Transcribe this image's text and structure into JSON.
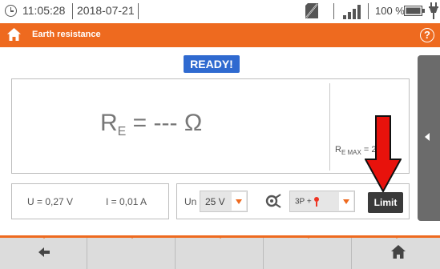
{
  "statusbar": {
    "time": "11:05:28",
    "date": "2018-07-21",
    "battery_percent": "100 %",
    "icons": [
      "clock-icon",
      "sd-card-icon",
      "signal-icon",
      "battery-icon",
      "plug-icon"
    ]
  },
  "titlebar": {
    "title": "Earth resistance",
    "help_label": "?",
    "icons": [
      "home-icon",
      "help-icon"
    ]
  },
  "status_badge": "READY!",
  "measurement": {
    "symbol": "R",
    "subscript": "E",
    "value_text": " = --- Ω",
    "remax_symbol": "R",
    "remax_subscript": "E MAX",
    "remax_value": " = 2  Ω"
  },
  "readings": {
    "voltage": "U = 0,27 V",
    "current": "I = 0,01 A"
  },
  "controls": {
    "un_label": "Un",
    "un_value": "25 V",
    "method_value": "3P + ",
    "limit_label": "Limit"
  },
  "colors": {
    "accent": "#ee6a1f",
    "ready": "#2f6ad0",
    "arrow": "#e8120c"
  }
}
